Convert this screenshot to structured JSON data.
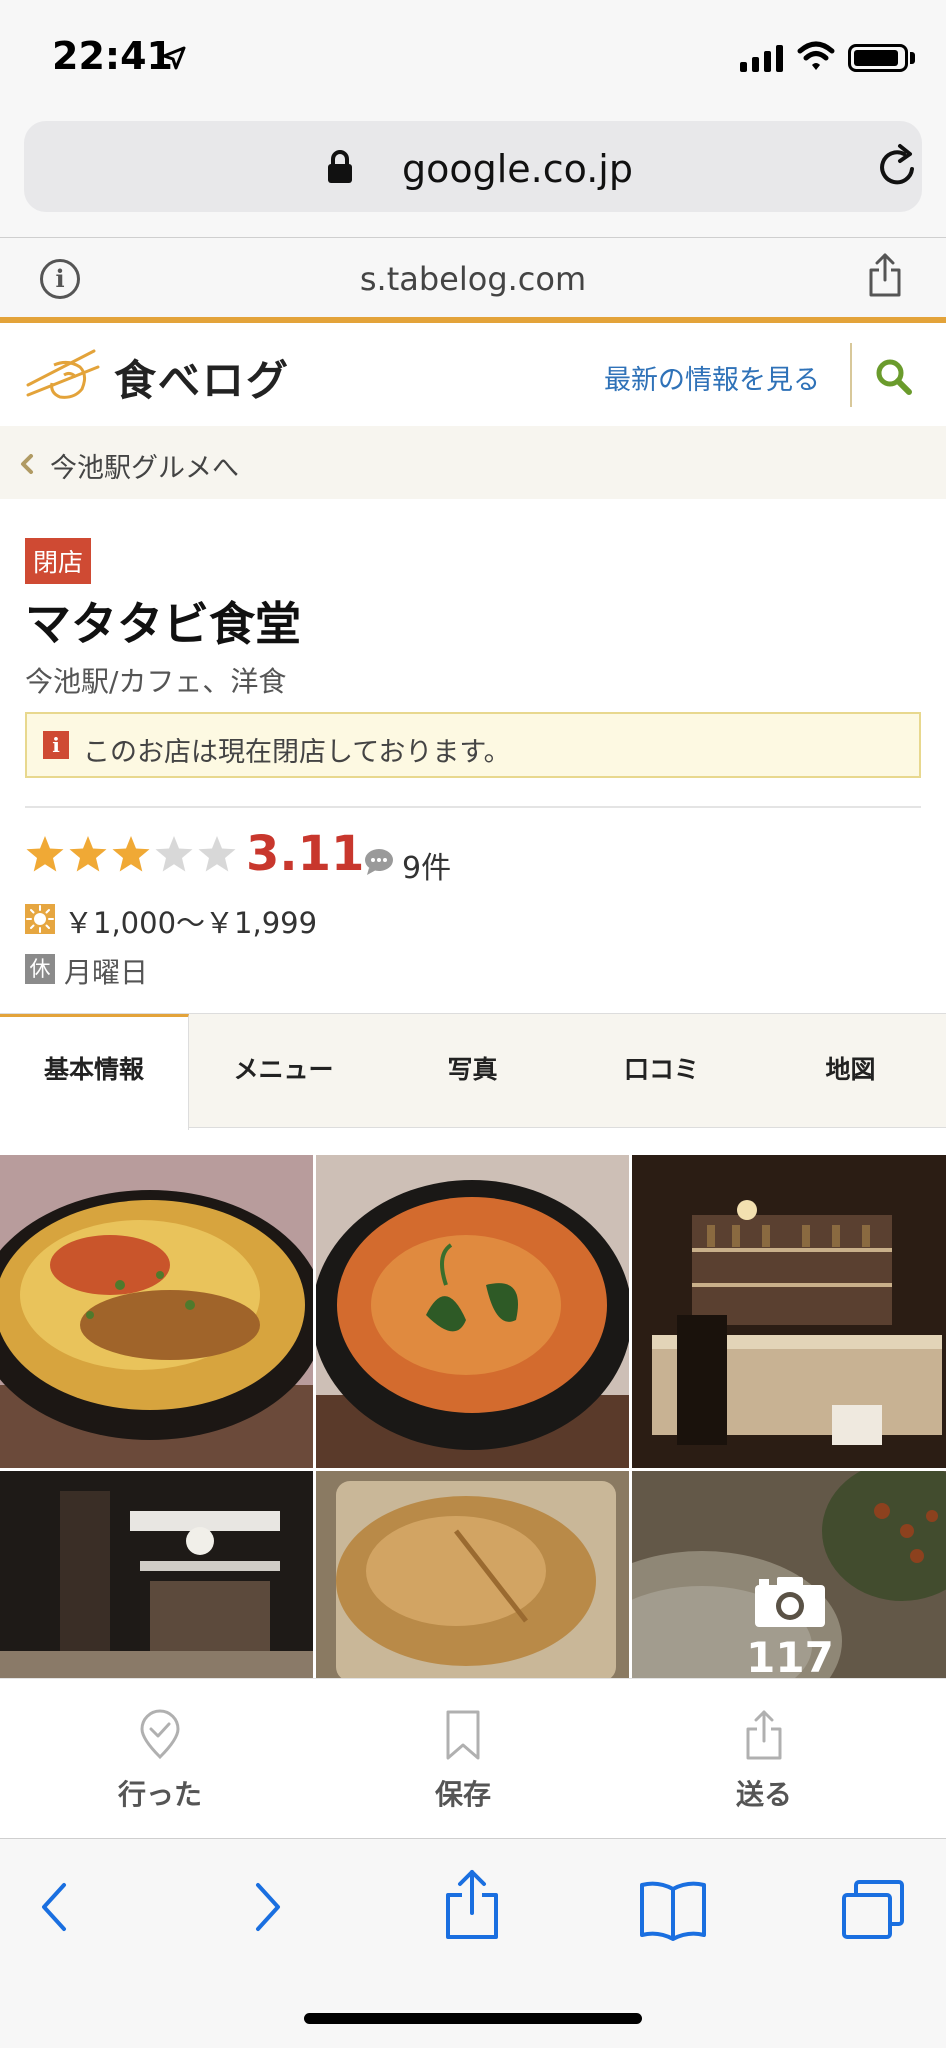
{
  "status_bar": {
    "time": "22:41"
  },
  "browser": {
    "url": "google.co.jp",
    "sub_url": "s.tabelog.com"
  },
  "site_header": {
    "logo_text": "食べログ",
    "latest_link": "最新の情報を見る"
  },
  "breadcrumb": {
    "label": "今池駅グルメへ"
  },
  "restaurant": {
    "closed_badge": "閉店",
    "name": "マタタビ食堂",
    "genre": "今池駅/カフェ、洋食",
    "notice": "このお店は現在閉店しております。",
    "rating": 3.11,
    "rating_text": "3.11",
    "stars_filled": 3,
    "stars_total": 5,
    "review_count": "9件",
    "price_range": "￥1,000～￥1,999",
    "closed_day_icon": "休",
    "closed_day": "月曜日"
  },
  "tabs": [
    {
      "label": "基本情報",
      "active": true
    },
    {
      "label": "メニュー",
      "active": false
    },
    {
      "label": "写真",
      "active": false
    },
    {
      "label": "口コミ",
      "active": false
    },
    {
      "label": "地図",
      "active": false
    }
  ],
  "photos": {
    "count": "117",
    "items": [
      "katsu-rice-bowl-photo",
      "curry-soup-photo",
      "bar-counter-photo",
      "kitchen-shelf-photo",
      "fried-cutlet-photo",
      "salad-bowl-photo"
    ]
  },
  "actions": [
    {
      "label": "行った",
      "icon": "check-pin-icon"
    },
    {
      "label": "保存",
      "icon": "bookmark-icon"
    },
    {
      "label": "送る",
      "icon": "share-icon"
    }
  ],
  "colors": {
    "accent_orange": "#e3a33a",
    "link_blue": "#2f72b8",
    "rating_red": "#c8372d",
    "closed_red": "#cf4a33",
    "safari_blue": "#1a6fe0",
    "search_green": "#6a9b2c"
  }
}
